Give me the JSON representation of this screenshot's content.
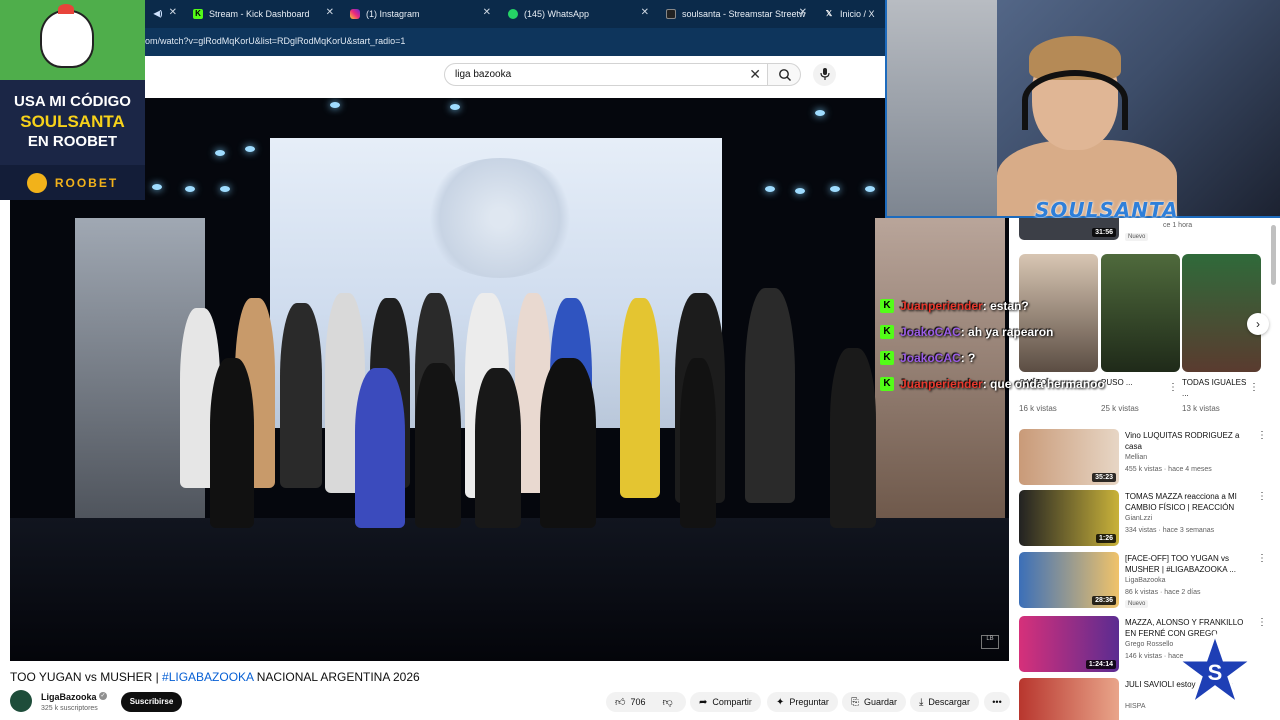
{
  "browser": {
    "tabs": [
      {
        "title": "",
        "icon": "speaker-icon"
      },
      {
        "title": "Stream - Kick Dashboard",
        "icon": "kick-icon"
      },
      {
        "title": "(1) Instagram",
        "icon": "instagram-icon"
      },
      {
        "title": "(145) WhatsApp",
        "icon": "whatsapp-icon"
      },
      {
        "title": "soulsanta - Streamstar Streetw",
        "icon": "streamstar-icon"
      },
      {
        "title": "Inicio / X",
        "icon": "x-icon"
      }
    ],
    "url": "om/watch?v=glRodMqKorU&list=RDglRodMqKorU&start_radio=1"
  },
  "youtube": {
    "search_value": "liga bazooka",
    "video": {
      "title_prefix": "TOO YUGAN vs MUSHER | ",
      "title_tag": "#LIGABAZOOKA",
      "title_suffix": " NACIONAL ARGENTINA 2026",
      "channel": "LigaBazooka",
      "subscribers": "325 k suscriptores",
      "subscribe_label": "Suscribirse",
      "like_count": "706",
      "actions": {
        "share": "Compartir",
        "ask": "Preguntar",
        "save": "Guardar",
        "download": "Descargar"
      }
    },
    "shorts": [
      {
        "title": "CANTO ...",
        "views": "16 k vistas"
      },
      {
        "title": "PUSO ...",
        "views": "25 k vistas"
      },
      {
        "title": "TODAS IGUALES ...",
        "views": "13 k vistas"
      }
    ],
    "partial_top": {
      "duration": "31:56",
      "meta": "ce 1 hora",
      "badge": "Nuevo"
    },
    "recommended": [
      {
        "title": "Vino LUQUITAS RODRIGUEZ a casa",
        "channel": "Mellian",
        "meta": "455 k vistas · hace 4 meses",
        "duration": "35:23",
        "badge": ""
      },
      {
        "title": "TOMAS MAZZA reacciona a MI CAMBIO FÍSICO | REACCIÓN",
        "channel": "GianLzzi",
        "meta": "334 vistas · hace 3 semanas",
        "duration": "1:26",
        "badge": ""
      },
      {
        "title": "[FACE-OFF] TOO YUGAN vs MUSHER | #LIGABAZOOKA ...",
        "channel": "LigaBazooka",
        "meta": "86 k vistas · hace 2 días",
        "duration": "28:36",
        "badge": "Nuevo"
      },
      {
        "title": "MAZZA, ALONSO Y FRANKILLO EN FERNÉ CON GREGO",
        "channel": "Grego Rossello",
        "meta": "146 k vistas · hace",
        "duration": "1:24:14",
        "badge": ""
      },
      {
        "title": "JULI SAVIOLI estoy realmente",
        "channel": "HISPA",
        "meta": "",
        "duration": "",
        "badge": ""
      }
    ]
  },
  "sponsor": {
    "line1": "USA MI CÓDIGO",
    "line2": "SOULSANTA",
    "line3": "EN ROOBET",
    "brand": "ROOBET"
  },
  "webcam": {
    "logo_text": "SOULSANTA"
  },
  "chat": [
    {
      "user": "Juanperiender",
      "message": ": estan?",
      "color": "#e8382d"
    },
    {
      "user": "JoakoCAC",
      "message": ": ah ya rapearon",
      "color": "#9b5de5"
    },
    {
      "user": "JoakoCAC",
      "message": ": ?",
      "color": "#9b5de5"
    },
    {
      "user": "Juanperiender",
      "message": ": que onda hermanoo",
      "color": "#e8382d"
    }
  ]
}
